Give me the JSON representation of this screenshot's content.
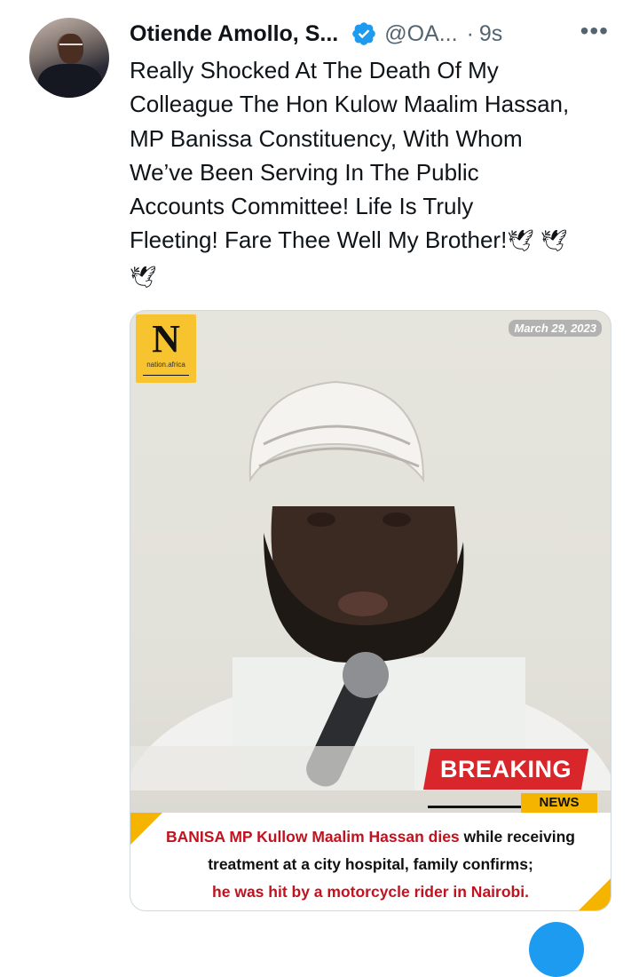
{
  "tweet": {
    "author_name": "Otiende Amollo, S...",
    "handle": "@OA...",
    "separator": "·",
    "time": "9s",
    "more_label": "•••",
    "text": "Really Shocked At The Death Of My\nColleague The Hon Kulow Maalim Hassan,\nMP Banissa Constituency, With Whom\nWe’ve Been Serving In The Public\nAccounts Committee! Life Is Truly\nFleeting! Fare Thee Well My Brother!",
    "dove_1": "🕊",
    "dove_2": "🕊",
    "dove_3": "🕊"
  },
  "media": {
    "logo_letter": "N",
    "logo_sub": "nation.africa",
    "date": "March 29, 2023",
    "breaking": "BREAKING",
    "news": "NEWS",
    "caption_red_1": "BANISA MP Kullow Maalim Hassan dies",
    "caption_black_1": " while receiving treatment at a city hospital, family confirms;",
    "caption_red_2": "he was hit by a motorcycle rider in Nairobi."
  },
  "colors": {
    "accent": "#1d9bf0",
    "breaking_red": "#d8262a",
    "nation_yellow": "#f7c32e",
    "news_yellow": "#f4b400"
  },
  "icons": [
    "verified-badge-icon",
    "more-options-icon",
    "dove-emoji",
    "compose-fab"
  ]
}
